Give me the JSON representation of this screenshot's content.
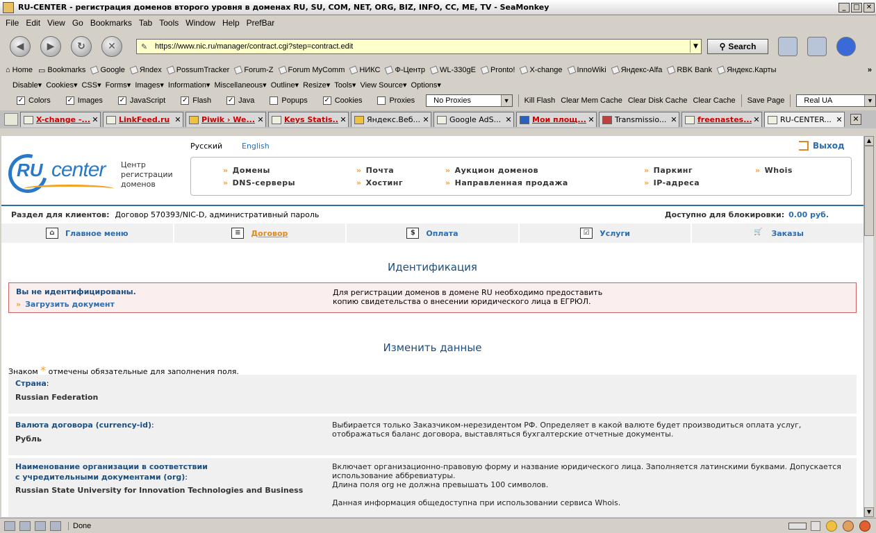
{
  "window": {
    "title": "RU-CENTER - регистрация доменов второго уровня в доменах RU, SU, COM, NET, ORG, BIZ, INFO, CC, ME, TV - SeaMonkey",
    "min": "_",
    "max": "□",
    "close": "✕"
  },
  "menubar": [
    "File",
    "Edit",
    "View",
    "Go",
    "Bookmarks",
    "Tab",
    "Tools",
    "Window",
    "Help",
    "PrefBar"
  ],
  "navbar": {
    "url": "https://www.nic.ru/manager/contract.cgi?step=contract.edit",
    "search_label": "Search"
  },
  "bookmarks": [
    "Home",
    "Bookmarks",
    "Google",
    "Яndex",
    "PossumTracker",
    "Forum-Z",
    "Forum MyComm",
    "НИКС",
    "Ф-Центр",
    "WL-330gE",
    "Pronto!",
    "X-change",
    "InnoWiki",
    "Яндекс-Alfa",
    "RBK Bank",
    "Яндекс.Карты"
  ],
  "prefbar_menus": [
    "Disable▾",
    "Cookies▾",
    "CSS▾",
    "Forms▾",
    "Images▾",
    "Information▾",
    "Miscellaneous▾",
    "Outline▾",
    "Resize▾",
    "Tools▾",
    "View Source▾",
    "Options▾"
  ],
  "prefbar_checks": [
    {
      "label": "Colors",
      "checked": true
    },
    {
      "label": "Images",
      "checked": true
    },
    {
      "label": "JavaScript",
      "checked": true
    },
    {
      "label": "Flash",
      "checked": true
    },
    {
      "label": "Java",
      "checked": true
    },
    {
      "label": "Popups",
      "checked": false
    },
    {
      "label": "Cookies",
      "checked": true
    },
    {
      "label": "Proxies",
      "checked": false
    }
  ],
  "prefbar_proxy_select": "No Proxies",
  "prefbar_buttons": [
    "Kill Flash",
    "Clear Mem Cache",
    "Clear Disk Cache",
    "Clear Cache",
    "Save Page"
  ],
  "prefbar_ua_select": "Real UA",
  "tabs": [
    {
      "label": "X-change -...",
      "red": true
    },
    {
      "label": "LinkFeed.ru",
      "red": true
    },
    {
      "label": "Piwik › We...",
      "red": true
    },
    {
      "label": "Keys Statis...",
      "red": true
    },
    {
      "label": "Яндекс.Веб...",
      "red": false
    },
    {
      "label": "Google AdS...",
      "red": false
    },
    {
      "label": "Мои площ...",
      "red": true
    },
    {
      "label": "Transmissio...",
      "red": false
    },
    {
      "label": "freenastes...",
      "red": true
    },
    {
      "label": "RU-CENTER...",
      "red": false
    }
  ],
  "site": {
    "logo_ru": "RU",
    "logo_center": "center",
    "tagline": "Центр регистрации доменов",
    "lang_ru": "Русский",
    "lang_en": "English",
    "logout": "Выход",
    "topmenu": [
      "Домены",
      "Почта",
      "Аукцион доменов",
      "Паркинг",
      "Whois",
      "DNS-серверы",
      "Хостинг",
      "Направленная продажа",
      "IP-адреса"
    ],
    "client_label": "Раздел для клиентов:",
    "client_value": "Договор 570393/NIC-D, административный пароль",
    "balance_label": "Доступно для блокировки:",
    "balance_value": "0.00 руб.",
    "mainnav": [
      "Главное меню",
      "Договор",
      "Оплата",
      "Услуги",
      "Заказы"
    ],
    "mainnav_icons": [
      "⌂",
      "≡",
      "$",
      "☑",
      "🛒"
    ],
    "ident_title": "Идентификация",
    "alert_title": "Вы не идентифицированы.",
    "alert_link": "Загрузить документ",
    "alert_text1": "Для регистрации доменов в домене RU необходимо предоставить",
    "alert_text2": "копию свидетельства о внесении юридического лица в ЕГРЮЛ.",
    "edit_title": "Изменить данные",
    "required_pre": "Знаком",
    "required_star": "*",
    "required_post": "отмечены обязательные для заполнения поля.",
    "fields": [
      {
        "label": "Страна",
        "value": "Russian Federation",
        "desc": []
      },
      {
        "label": "Валюта договора (currency-id)",
        "value": "Рубль",
        "desc": [
          "Выбирается только Заказчиком-нерезидентом РФ. Определяет в какой валюте будет производиться оплата услуг,",
          "отображаться баланс договора, выставляться бухгалтерские отчетные документы."
        ]
      },
      {
        "label": "Наименование организации в соответствии",
        "label2": "с учредительными документами (org)",
        "value": "Russian State University for Innovation Technologies and Business",
        "desc": [
          "Включает организационно-правовую форму и название юридического лица. Заполняется латинскими буквами. Допускается",
          "использование аббревиатуры.",
          "Длина поля org не должна превышать 100 символов.",
          "",
          "Данная информация общедоступна при использовании сервиса Whois."
        ]
      }
    ]
  },
  "status": {
    "text": "Done"
  }
}
